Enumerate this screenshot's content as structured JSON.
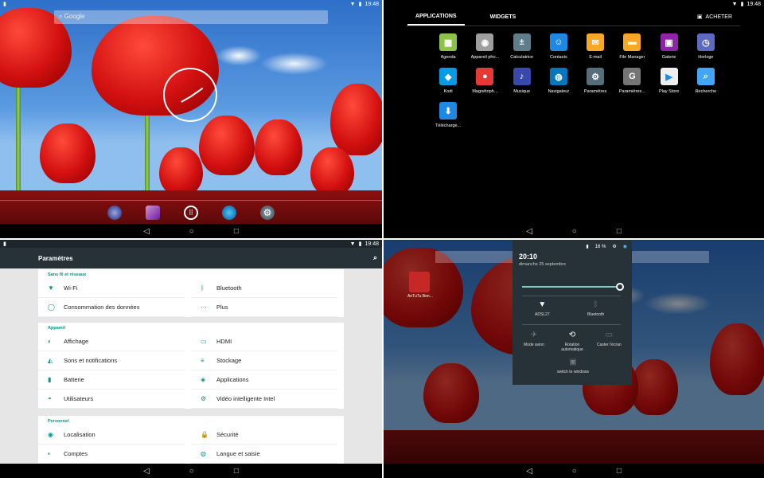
{
  "status": {
    "time": "19:48",
    "battery_q4": "16 %"
  },
  "launcher": {
    "search_placeholder": "Google"
  },
  "nav": {
    "back": "◁",
    "home": "○",
    "recent": "□"
  },
  "drawer": {
    "tabs": [
      "APPLICATIONS",
      "WIDGETS"
    ],
    "buy_label": "ACHETER",
    "apps": [
      {
        "label": "Agenda",
        "color": "#8bc34a",
        "glyph": "▦"
      },
      {
        "label": "Appareil pho...",
        "color": "#9e9e9e",
        "glyph": "◉"
      },
      {
        "label": "Calculatrice",
        "color": "#607d8b",
        "glyph": "±"
      },
      {
        "label": "Contacts",
        "color": "#1e88e5",
        "glyph": "☺"
      },
      {
        "label": "E-mail",
        "color": "#f9a825",
        "glyph": "✉"
      },
      {
        "label": "File Manager",
        "color": "#f9a825",
        "glyph": "▬"
      },
      {
        "label": "Galerie",
        "color": "#8e24aa",
        "glyph": "▣"
      },
      {
        "label": "Horloge",
        "color": "#5c6bc0",
        "glyph": "◷"
      },
      {
        "label": "Kodi",
        "color": "#039be5",
        "glyph": "◆"
      },
      {
        "label": "Magnétoph...",
        "color": "#e53935",
        "glyph": "●"
      },
      {
        "label": "Musique",
        "color": "#3949ab",
        "glyph": "♪"
      },
      {
        "label": "Navigateur",
        "color": "#0277bd",
        "glyph": "◍"
      },
      {
        "label": "Paramètres",
        "color": "#546e7a",
        "glyph": "⚙"
      },
      {
        "label": "Paramètres...",
        "color": "#757575",
        "glyph": "G"
      },
      {
        "label": "Play Store",
        "color": "#eeeeee",
        "glyph": "▶"
      },
      {
        "label": "Recherche",
        "color": "#42a5f5",
        "glyph": "⌕"
      },
      {
        "label": "Télécharge...",
        "color": "#1e88e5",
        "glyph": "⬇"
      }
    ]
  },
  "settings": {
    "title": "Paramètres",
    "sections": [
      {
        "header": "Sans fil et réseaux",
        "items": [
          {
            "label": "Wi-Fi",
            "glyph": "▼"
          },
          {
            "label": "Bluetooth",
            "glyph": "ᛒ"
          },
          {
            "label": "Consommation des données",
            "glyph": "◯"
          },
          {
            "label": "Plus",
            "glyph": "⋯"
          }
        ]
      },
      {
        "header": "Appareil",
        "items": [
          {
            "label": "Affichage",
            "glyph": "◐"
          },
          {
            "label": "HDMI",
            "glyph": "▭"
          },
          {
            "label": "Sons et notifications",
            "glyph": "◭"
          },
          {
            "label": "Stockage",
            "glyph": "≡"
          },
          {
            "label": "Batterie",
            "glyph": "▮"
          },
          {
            "label": "Applications",
            "glyph": "◈"
          },
          {
            "label": "Utilisateurs",
            "glyph": "◓"
          },
          {
            "label": "Vidéo intelligente Intel",
            "glyph": "⚙"
          }
        ]
      },
      {
        "header": "Personnel",
        "items": [
          {
            "label": "Localisation",
            "glyph": "◉"
          },
          {
            "label": "Sécurité",
            "glyph": "🔒"
          },
          {
            "label": "Comptes",
            "glyph": "▪"
          },
          {
            "label": "Langue et saisie",
            "glyph": "◍"
          }
        ]
      }
    ]
  },
  "shade": {
    "time": "20:10",
    "date": "dimanche 25 septembre",
    "app_label": "AnTuTu Ben...",
    "tiles": [
      {
        "label": "ADSL27",
        "glyph": "▼"
      },
      {
        "label": "Bluetooth",
        "glyph": "ᛒ"
      },
      {
        "label": "Mode avion",
        "glyph": "✈"
      },
      {
        "label": "Rotation automatique",
        "glyph": "⟲"
      },
      {
        "label": "Caster l'écran",
        "glyph": "▭"
      },
      {
        "label": "switch to windows",
        "glyph": "▣"
      }
    ]
  }
}
